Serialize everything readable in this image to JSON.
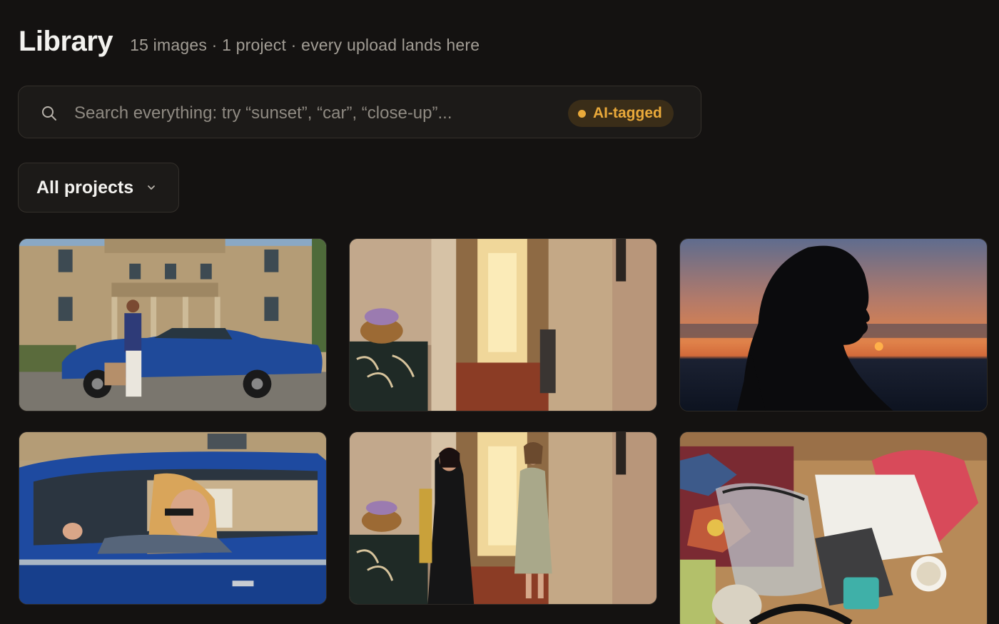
{
  "header": {
    "title": "Library",
    "subtitle": "15 images · 1 project · every upload lands here"
  },
  "search": {
    "placeholder": "Search everything: try “sunset”, “car”, “close-up”...",
    "value": "",
    "icon": "search-icon",
    "badge_label": "AI-tagged",
    "badge_color": "#e9a93a"
  },
  "filter": {
    "selected": "All projects",
    "icon": "chevron-down-icon"
  },
  "images": [
    {
      "subject": "woman with suitcase beside blue classic car in front of stone manor"
    },
    {
      "subject": "interior hallway with wicker basket on dark cabinet"
    },
    {
      "subject": "silhouette of woman at sunset over the sea"
    },
    {
      "subject": "woman wearing sunglasses driving blue classic car"
    },
    {
      "subject": "two women posing in sunlit hallway"
    },
    {
      "subject": "flat lay of clear makeup bag, notebook and coffee on table"
    }
  ]
}
